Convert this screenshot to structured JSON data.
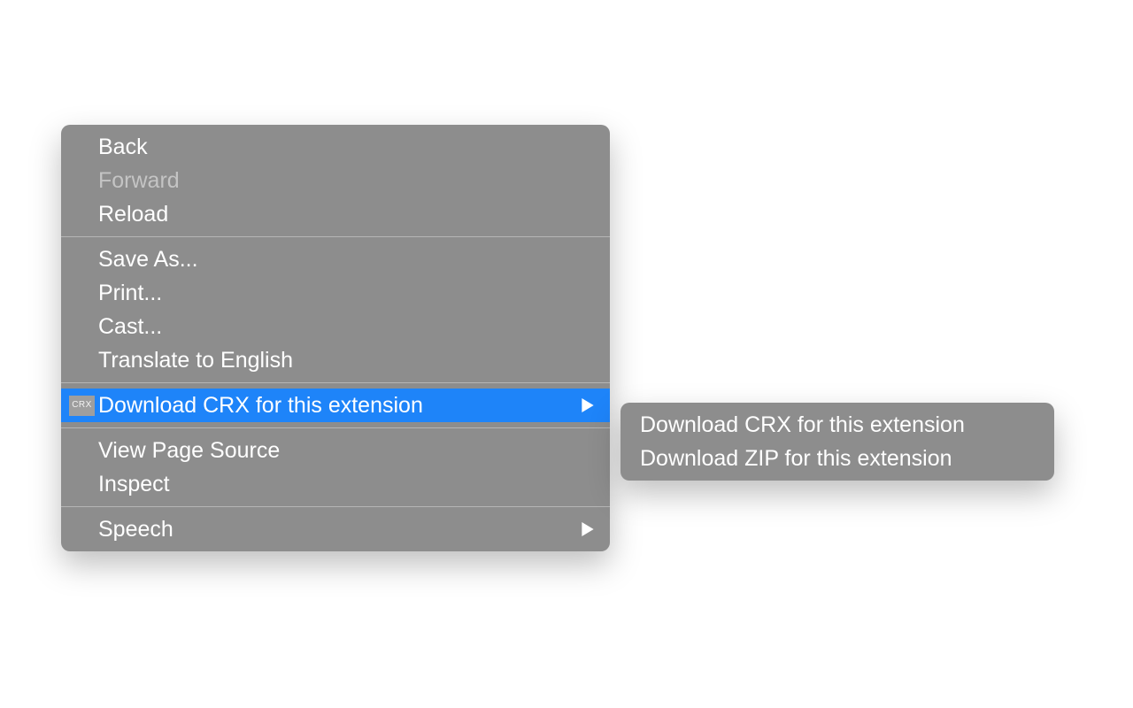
{
  "menu": {
    "group1": {
      "back": "Back",
      "forward": "Forward",
      "reload": "Reload"
    },
    "group2": {
      "save_as": "Save As...",
      "print": "Print...",
      "cast": "Cast...",
      "translate": "Translate to English"
    },
    "group3": {
      "download_crx": {
        "label": "Download CRX for this extension",
        "icon_text": "CRX"
      }
    },
    "group4": {
      "view_source": "View Page Source",
      "inspect": "Inspect"
    },
    "group5": {
      "speech": "Speech"
    }
  },
  "submenu": {
    "download_crx": "Download CRX for this extension",
    "download_zip": "Download ZIP for this extension"
  }
}
